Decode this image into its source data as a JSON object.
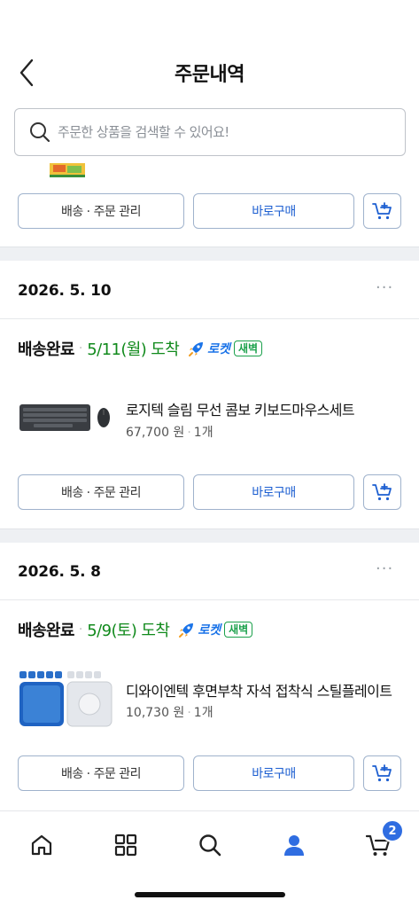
{
  "header": {
    "title": "주문내역"
  },
  "search": {
    "placeholder": "주문한 상품을 검색할 수 있어요!"
  },
  "actions": {
    "manage_label": "배송 · 주문 관리",
    "buy_again_label": "바로구매"
  },
  "orders": [
    {
      "date": "2026. 5. 10",
      "status": "배송완료",
      "arrival": "5/11(월) 도착",
      "badge_rocket": "로켓",
      "badge_dawn": "새벽",
      "product": {
        "name": "로지텍 슬림 무선 콤보 키보드마우스세트",
        "price": "67,700 원",
        "qty": "1개"
      }
    },
    {
      "date": "2026. 5. 8",
      "status": "배송완료",
      "arrival": "5/9(토) 도착",
      "badge_rocket": "로켓",
      "badge_dawn": "새벽",
      "product": {
        "name": "디와이엔텍 후면부착 자석 접착식 스틸플레이트",
        "price": "10,730 원",
        "qty": "1개"
      }
    }
  ],
  "more_label": "···",
  "tabbar": {
    "items": [
      "home-icon",
      "grid-icon",
      "search-icon",
      "person-icon",
      "cart-icon"
    ],
    "cart_count": "2",
    "active_color": "#2f6de1"
  }
}
